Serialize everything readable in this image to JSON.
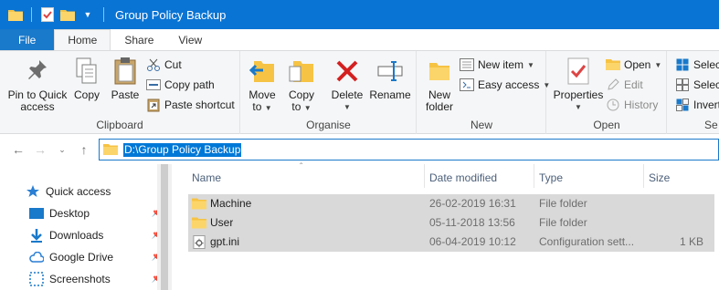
{
  "window": {
    "title": "Group Policy Backup"
  },
  "ribbon_tabs": [
    "File",
    "Home",
    "Share",
    "View"
  ],
  "clipboard": {
    "pin_label": "Pin to Quick access",
    "pin_line1": "Pin to Quick",
    "pin_line2": "access",
    "copy": "Copy",
    "paste": "Paste",
    "cut": "Cut",
    "copy_path": "Copy path",
    "paste_shortcut": "Paste shortcut",
    "group": "Clipboard"
  },
  "organise": {
    "move_to_line1": "Move",
    "move_to_line2": "to",
    "copy_to_line1": "Copy",
    "copy_to_line2": "to",
    "delete": "Delete",
    "rename": "Rename",
    "group": "Organise"
  },
  "new": {
    "new_folder_line1": "New",
    "new_folder_line2": "folder",
    "new_item": "New item",
    "easy_access": "Easy access",
    "group": "New"
  },
  "open": {
    "properties": "Properties",
    "open": "Open",
    "edit": "Edit",
    "history": "History",
    "group": "Open"
  },
  "select": {
    "select_all": "Select",
    "select_none": "Select",
    "invert": "Invert",
    "group": "Se"
  },
  "address": {
    "path": "D:\\Group Policy Backup"
  },
  "nav_pane": {
    "items": [
      {
        "label": "Quick access",
        "icon": "star-icon"
      },
      {
        "label": "Desktop",
        "icon": "desktop-icon"
      },
      {
        "label": "Downloads",
        "icon": "download-icon"
      },
      {
        "label": "Google Drive",
        "icon": "cloud-icon"
      },
      {
        "label": "Screenshots",
        "icon": "screenshot-icon"
      }
    ]
  },
  "columns": {
    "name": "Name",
    "date": "Date modified",
    "type": "Type",
    "size": "Size"
  },
  "files": [
    {
      "name": "Machine",
      "date": "26-02-2019 16:31",
      "type": "File folder",
      "size": "",
      "icon": "folder-icon"
    },
    {
      "name": "User",
      "date": "05-11-2018 13:56",
      "type": "File folder",
      "size": "",
      "icon": "folder-icon"
    },
    {
      "name": "gpt.ini",
      "date": "06-04-2019 10:12",
      "type": "Configuration sett...",
      "size": "1 KB",
      "icon": "settings-file-icon"
    }
  ],
  "colors": {
    "titlebar": "#0a74d4",
    "file_tab": "#1979ca",
    "selection": "#d9d9d9",
    "folder": "#f6c344"
  }
}
